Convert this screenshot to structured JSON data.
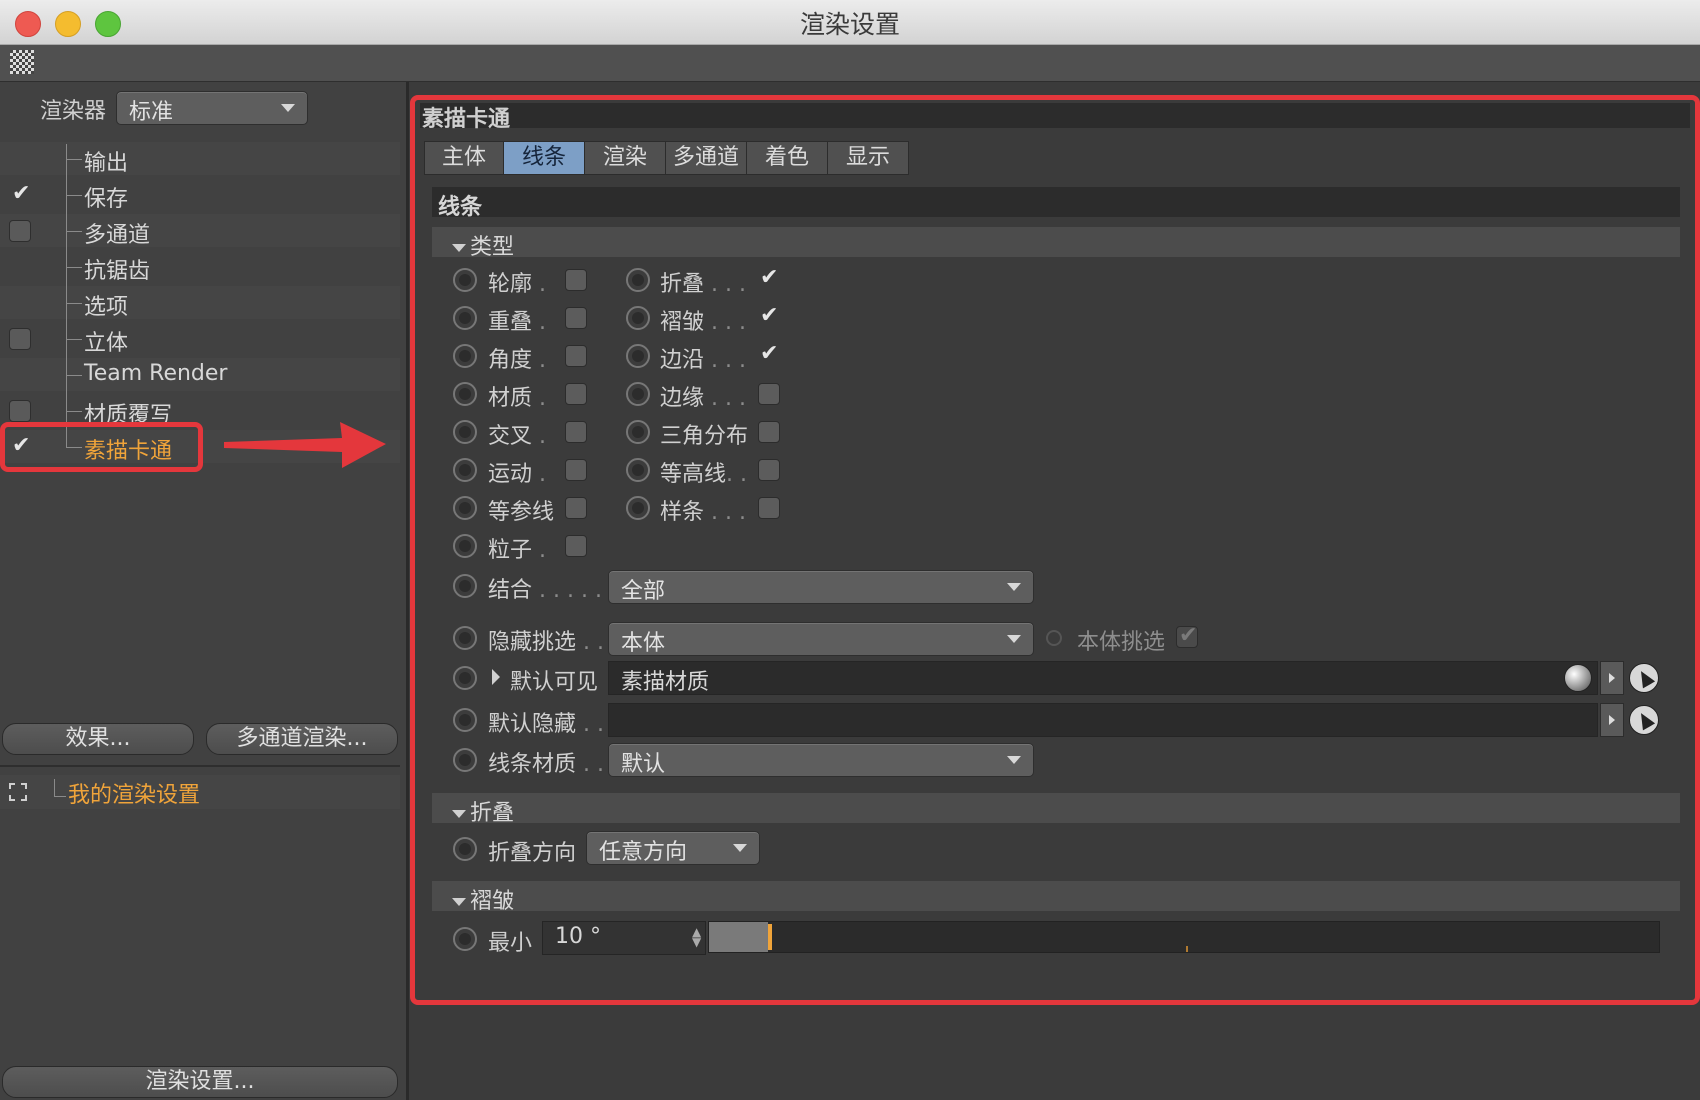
{
  "window": {
    "title": "渲染设置"
  },
  "colors": {
    "accent_orange": "#f0a43a",
    "tab_active": "#7d9fc6",
    "annotation_red": "#e4373c"
  },
  "left_panel": {
    "renderer_label": "渲染器",
    "renderer_value": "标准",
    "tree": [
      {
        "label": "输出",
        "has_checkbox": false,
        "checked": false
      },
      {
        "label": "保存",
        "has_checkbox": true,
        "checked": true
      },
      {
        "label": "多通道",
        "has_checkbox": true,
        "checked": false
      },
      {
        "label": "抗锯齿",
        "has_checkbox": false,
        "checked": false
      },
      {
        "label": "选项",
        "has_checkbox": false,
        "checked": false
      },
      {
        "label": "立体",
        "has_checkbox": true,
        "checked": false
      },
      {
        "label": "Team Render",
        "has_checkbox": false,
        "checked": false
      },
      {
        "label": "材质覆写",
        "has_checkbox": true,
        "checked": false
      },
      {
        "label": "素描卡通",
        "has_checkbox": true,
        "checked": true,
        "selected": true
      }
    ],
    "effects_button": "效果...",
    "multipass_button": "多通道渲染...",
    "preset_label": "我的渲染设置",
    "render_settings_button": "渲染设置..."
  },
  "right_panel": {
    "section_title": "素描卡通",
    "tabs": [
      "主体",
      "线条",
      "渲染",
      "多通道",
      "着色",
      "显示"
    ],
    "active_tab": "线条",
    "subsection": "线条",
    "type_group": {
      "label": "类型",
      "left_col": [
        {
          "label": "轮廓",
          "dots": " .",
          "checked": false
        },
        {
          "label": "重叠",
          "dots": " .",
          "checked": false
        },
        {
          "label": "角度",
          "dots": " .",
          "checked": false
        },
        {
          "label": "材质",
          "dots": " .",
          "checked": false
        },
        {
          "label": "交叉",
          "dots": " .",
          "checked": false
        },
        {
          "label": "运动",
          "dots": " .",
          "checked": false
        },
        {
          "label": "等参线",
          "dots": "",
          "checked": false
        },
        {
          "label": "粒子",
          "dots": " .",
          "checked": false
        }
      ],
      "right_col": [
        {
          "label": "折叠",
          "dots": " . . .",
          "checked": true
        },
        {
          "label": "褶皱",
          "dots": " . . .",
          "checked": true
        },
        {
          "label": "边沿",
          "dots": " . . .",
          "checked": true
        },
        {
          "label": "边缘",
          "dots": " . . .",
          "checked": false
        },
        {
          "label": "三角分布",
          "dots": "",
          "checked": false
        },
        {
          "label": "等高线",
          "dots": ". .",
          "checked": false
        },
        {
          "label": "样条",
          "dots": " . . .",
          "checked": false
        }
      ],
      "combine_label": "结合",
      "combine_dots": " . . . . .",
      "combine_value": "全部",
      "hide_pick_label": "隐藏挑选",
      "hide_pick_dots": " . .",
      "hide_pick_value": "本体",
      "object_pick_label": "本体挑选",
      "default_visible_label": "默认可见",
      "default_visible_value": "素描材质",
      "default_hidden_label": "默认隐藏",
      "default_hidden_dots": " . .",
      "default_hidden_value": "",
      "line_material_label": "线条材质",
      "line_material_dots": " . .",
      "line_material_value": "默认"
    },
    "fold_group": {
      "label": "折叠",
      "direction_label": "折叠方向",
      "direction_value": "任意方向"
    },
    "crease_group": {
      "label": "褶皱",
      "min_label": "最小",
      "min_value": "10 °",
      "slider_fraction": 0.03
    }
  }
}
